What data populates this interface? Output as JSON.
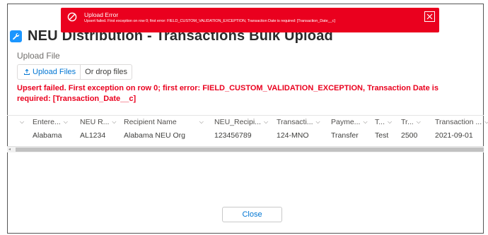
{
  "page": {
    "title": "NEU Distribution - Transactions Bulk Upload"
  },
  "toast": {
    "title": "Upload Error",
    "message": "Upsert failed. First exception on row 0; first error: FIELD_CUSTOM_VALIDATION_EXCEPTION, Transaction Date is required: [Transaction_Date__c]"
  },
  "upload": {
    "label": "Upload File",
    "button_label": "Upload Files",
    "drop_text": "Or drop files"
  },
  "error_message": "Upsert failed. First exception on row 0; first error: FIELD_CUSTOM_VALIDATION_EXCEPTION, Transaction Date is required: [Transaction_Date__c]",
  "table": {
    "columns": [
      "Entere...",
      "NEU R...",
      "Recipient Name",
      "NEU_Recipi...",
      "Transacti...",
      "Payme...",
      "T...",
      "Tr...",
      "Transaction ..."
    ],
    "rows": [
      {
        "cells": [
          "Alabama",
          "AL1234",
          "Alabama NEU Org",
          "123456789",
          "124-MNO",
          "Transfer",
          "Test",
          "2500",
          "2021-09-01"
        ]
      }
    ]
  },
  "footer": {
    "close_label": "Close"
  },
  "colors": {
    "toast_bg": "#ea001e",
    "error_text": "#ea001e",
    "link": "#0176d3"
  }
}
